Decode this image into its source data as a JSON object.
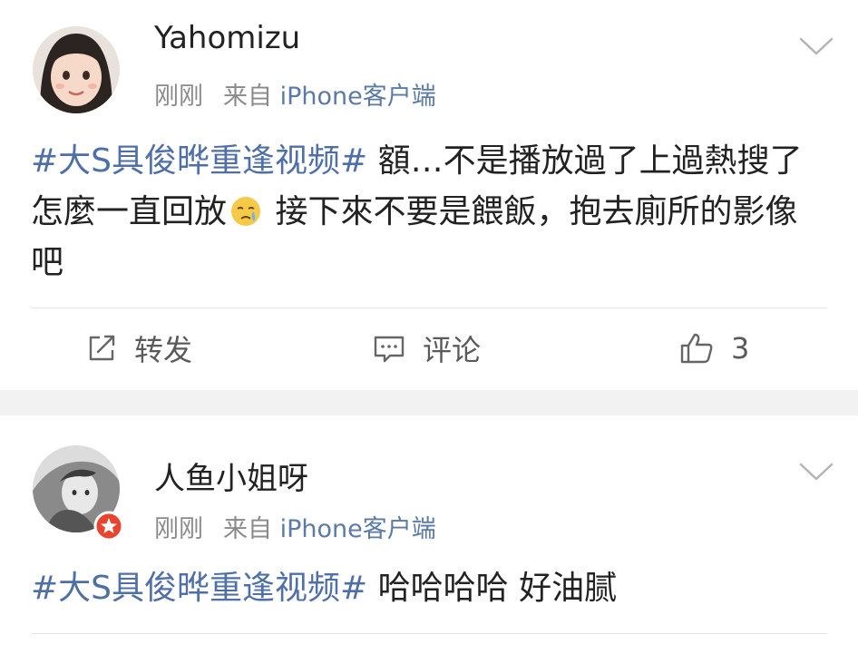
{
  "posts": [
    {
      "username": "Yahomizu",
      "time": "刚刚",
      "source_prefix": "来自",
      "source": "iPhone客户端",
      "hashtag": "#大S具俊晔重逢视频#",
      "text_before_emoji": " 額…不是播放過了上過熱搜了 怎麼一直回放",
      "emoji": "crying-face-emoji",
      "text_after_emoji": " 接下來不要是餵飯，抱去廁所的影像吧",
      "actions": {
        "repost_label": "转发",
        "comment_label": "评论",
        "like_count": "3"
      }
    },
    {
      "username": "人鱼小姐呀",
      "time": "刚刚",
      "source_prefix": "来自",
      "source": "iPhone客户端",
      "hashtag": "#大S具俊晔重逢视频#",
      "text": " 哈哈哈哈 好油腻"
    }
  ],
  "colors": {
    "hashtag": "#4f6fa8",
    "source": "#5b7aa7",
    "meta": "#8a8a8a",
    "text": "#222222",
    "badge": "#e8442e",
    "separator": "#f2f2f2"
  }
}
